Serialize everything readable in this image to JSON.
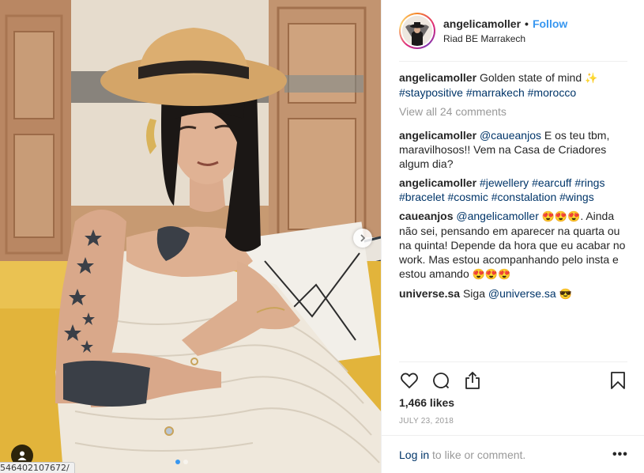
{
  "header": {
    "username": "angelicamoller",
    "separator": "•",
    "follow_label": "Follow",
    "location": "Riad BE Marrakech"
  },
  "caption": {
    "username": "angelicamoller",
    "text": "Golden state of mind",
    "emoji": "✨",
    "hashtags": [
      "#staypositive",
      "#marrakech",
      "#morocco"
    ]
  },
  "view_all_label": "View all 24 comments",
  "comments": [
    {
      "username": "angelicamoller",
      "mention": "@caueanjos",
      "text": "E os teu tbm, maravilhosos!! Vem na Casa de Criadores algum dia?"
    },
    {
      "username": "angelicamoller",
      "hashtags": [
        "#jewellery",
        "#earcuff",
        "#rings",
        "#bracelet",
        "#cosmic",
        "#constalation",
        "#wings"
      ]
    },
    {
      "username": "caueanjos",
      "mention": "@angelicamoller",
      "emoji_a": "😍😍😍",
      "text": ". Ainda não sei, pensando em aparecer na quarta ou na quinta! Depende da hora que eu acabar no work. Mas estou acompanhando pelo insta e estou amando",
      "emoji_b": "😍😍😍"
    },
    {
      "username": "universe.sa",
      "text": "Siga",
      "mention": "@universe.sa",
      "emoji": "😎"
    }
  ],
  "actions": {
    "like_icon": "heart-icon",
    "comment_icon": "comment-icon",
    "share_icon": "share-icon",
    "save_icon": "bookmark-icon"
  },
  "likes_label": "1,466 likes",
  "date_label": "JULY 23, 2018",
  "login": {
    "link_label": "Log in",
    "text": "to like or comment.",
    "more_label": "•••"
  },
  "media": {
    "status_url": "546402107672/",
    "slide_count": 2,
    "active_slide": 1,
    "next_icon": "chevron-right-icon",
    "tag_icon": "user-icon"
  },
  "colors": {
    "link": "#3897f0",
    "hashtag": "#003569",
    "secondary_text": "#999999"
  }
}
